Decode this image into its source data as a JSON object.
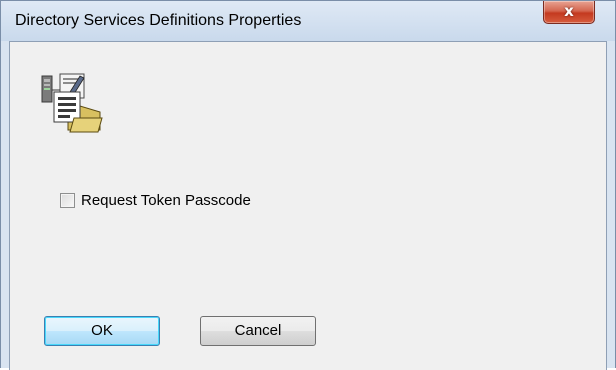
{
  "window": {
    "title": "Directory Services Definitions Properties",
    "close_label": "x"
  },
  "icons": {
    "app_icon": "directory-services-icon",
    "close_icon": "close-icon"
  },
  "options": {
    "request_token_passcode": {
      "label": "Request Token Passcode",
      "checked": false
    }
  },
  "buttons": {
    "ok_label": "OK",
    "cancel_label": "Cancel"
  },
  "colors": {
    "titlebar": "#c9d9ec",
    "client_bg": "#f0f0f0",
    "close_button": "#c43a20",
    "default_button_border": "#3c7fb1"
  }
}
